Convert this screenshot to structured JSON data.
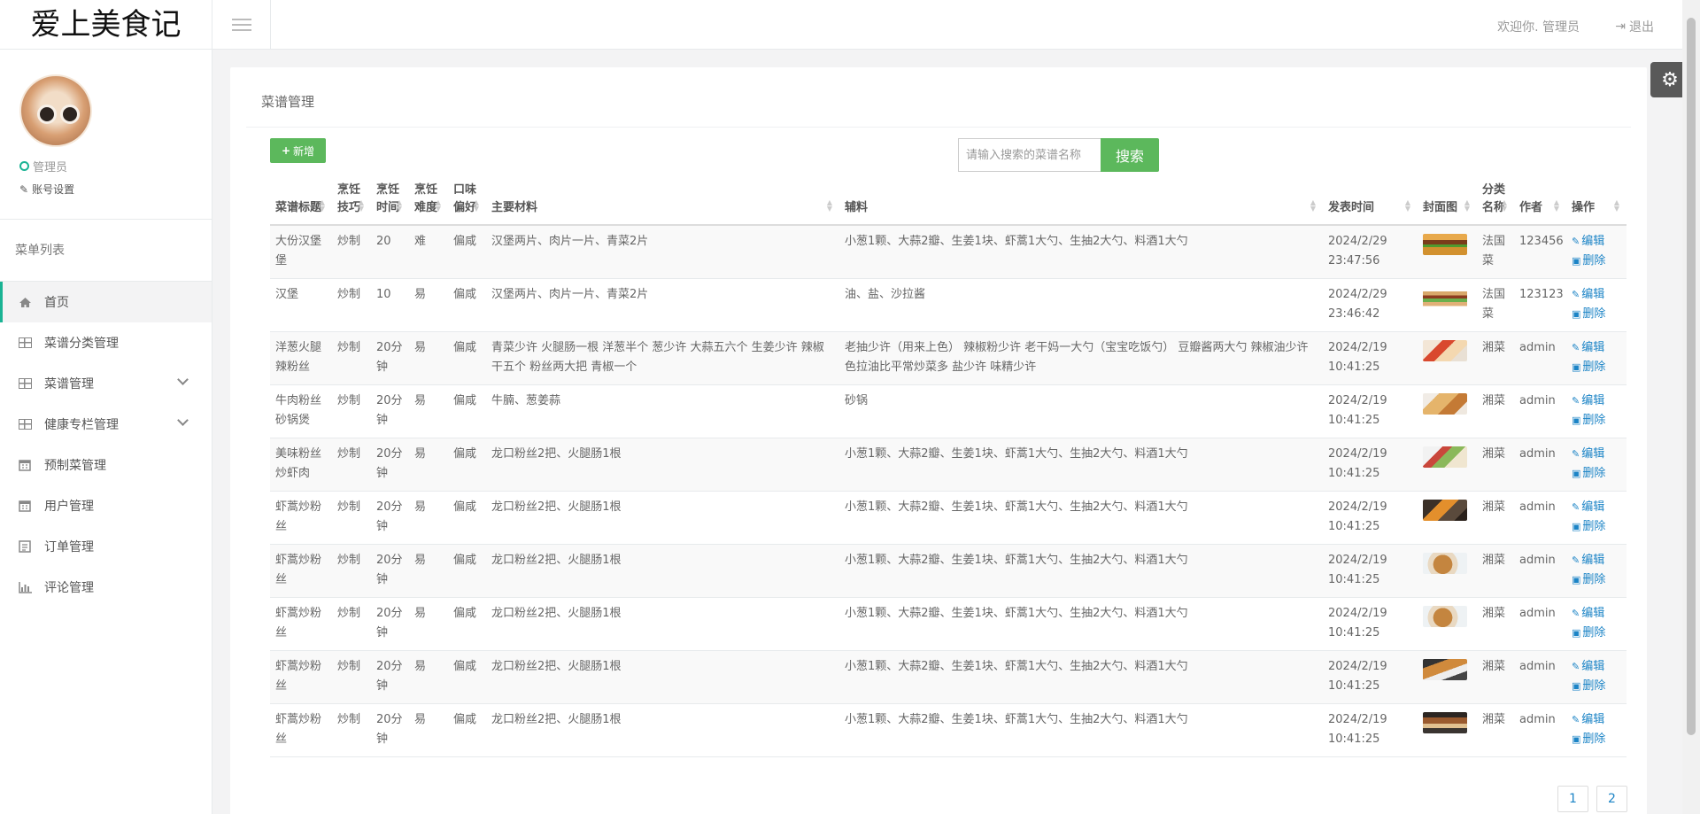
{
  "app": {
    "logo": "爱上美食记"
  },
  "profile": {
    "role": "管理员",
    "account_settings": "账号设置"
  },
  "menu": {
    "title": "菜单列表",
    "items": [
      {
        "label": "首页",
        "icon": "home-icon",
        "active": true,
        "expandable": false
      },
      {
        "label": "菜谱分类管理",
        "icon": "table-icon",
        "active": false,
        "expandable": false
      },
      {
        "label": "菜谱管理",
        "icon": "table-icon",
        "active": false,
        "expandable": true
      },
      {
        "label": "健康专栏管理",
        "icon": "table-icon",
        "active": false,
        "expandable": true
      },
      {
        "label": "预制菜管理",
        "icon": "calendar-icon",
        "active": false,
        "expandable": false
      },
      {
        "label": "用户管理",
        "icon": "calendar-icon",
        "active": false,
        "expandable": false
      },
      {
        "label": "订单管理",
        "icon": "list-icon",
        "active": false,
        "expandable": false
      },
      {
        "label": "评论管理",
        "icon": "bar-chart-icon",
        "active": false,
        "expandable": false
      }
    ]
  },
  "topbar": {
    "welcome": "欢迎你. 管理员",
    "logout": "退出"
  },
  "panel": {
    "title": "菜谱管理",
    "add_button": "新增",
    "search_placeholder": "请输入搜索的菜谱名称",
    "search_button": "搜索"
  },
  "table": {
    "headers": [
      "菜谱标题",
      "烹饪技巧",
      "烹饪时间",
      "烹饪难度",
      "口味偏好",
      "主要材料",
      "辅料",
      "发表时间",
      "封面图",
      "分类名称",
      "作者",
      "操作"
    ],
    "edit_label": "编辑",
    "delete_label": "删除",
    "rows": [
      {
        "title": "大份汉堡堡",
        "technique": "炒制",
        "time": "20",
        "difficulty": "难",
        "taste": "偏咸",
        "main": "汉堡两片、肉片一片、青菜2片",
        "aux": "小葱1颗、大蒜2瓣、生姜1块、虾蒿1大勺、生抽2大勺、料酒1大勺",
        "date": "2024/2/29",
        "clock": "23:47:56",
        "cover": "burger",
        "category": "法国菜",
        "author": "123456"
      },
      {
        "title": "汉堡",
        "technique": "炒制",
        "time": "10",
        "difficulty": "易",
        "taste": "偏咸",
        "main": "汉堡两片、肉片一片、青菜2片",
        "aux": "油、盐、沙拉酱",
        "date": "2024/2/29",
        "clock": "23:46:42",
        "cover": "sandwich",
        "category": "法国菜",
        "author": "123123"
      },
      {
        "title": "洋葱火腿辣粉丝",
        "technique": "炒制",
        "time": "20分钟",
        "difficulty": "易",
        "taste": "偏咸",
        "main": "青菜少许 火腿肠一根 洋葱半个 葱少许 大蒜五六个 生姜少许 辣椒干五个 粉丝两大把 青椒一个",
        "aux": "老抽少许（用来上色） 辣椒粉少许 老干妈一大勺（宝宝吃饭勺） 豆瓣酱两大勺 辣椒油少许 色拉油比平常炒菜多 盐少许 味精少许",
        "date": "2024/2/19",
        "clock": "10:41:25",
        "cover": "noodle-red",
        "category": "湘菜",
        "author": "admin"
      },
      {
        "title": "牛肉粉丝砂锅煲",
        "technique": "炒制",
        "time": "20分钟",
        "difficulty": "易",
        "taste": "偏咸",
        "main": "牛腩、葱姜蒜",
        "aux": "砂锅",
        "date": "2024/2/19",
        "clock": "10:41:25",
        "cover": "pot",
        "category": "湘菜",
        "author": "admin"
      },
      {
        "title": "美味粉丝炒虾肉",
        "technique": "炒制",
        "time": "20分钟",
        "difficulty": "易",
        "taste": "偏咸",
        "main": "龙口粉丝2把、火腿肠1根",
        "aux": "小葱1颗、大蒜2瓣、生姜1块、虾蒿1大勺、生抽2大勺、料酒1大勺",
        "date": "2024/2/19",
        "clock": "10:41:25",
        "cover": "salad",
        "category": "湘菜",
        "author": "admin"
      },
      {
        "title": "虾蒿炒粉丝",
        "technique": "炒制",
        "time": "20分钟",
        "difficulty": "易",
        "taste": "偏咸",
        "main": "龙口粉丝2把、火腿肠1根",
        "aux": "小葱1颗、大蒜2瓣、生姜1块、虾蒿1大勺、生抽2大勺、料酒1大勺",
        "date": "2024/2/19",
        "clock": "10:41:25",
        "cover": "dark",
        "category": "湘菜",
        "author": "admin"
      },
      {
        "title": "虾蒿炒粉丝",
        "technique": "炒制",
        "time": "20分钟",
        "difficulty": "易",
        "taste": "偏咸",
        "main": "龙口粉丝2把、火腿肠1根",
        "aux": "小葱1颗、大蒜2瓣、生姜1块、虾蒿1大勺、生抽2大勺、料酒1大勺",
        "date": "2024/2/19",
        "clock": "10:41:25",
        "cover": "soup",
        "category": "湘菜",
        "author": "admin"
      },
      {
        "title": "虾蒿炒粉丝",
        "technique": "炒制",
        "time": "20分钟",
        "difficulty": "易",
        "taste": "偏咸",
        "main": "龙口粉丝2把、火腿肠1根",
        "aux": "小葱1颗、大蒜2瓣、生姜1块、虾蒿1大勺、生抽2大勺、料酒1大勺",
        "date": "2024/2/19",
        "clock": "10:41:25",
        "cover": "soup",
        "category": "湘菜",
        "author": "admin"
      },
      {
        "title": "虾蒿炒粉丝",
        "technique": "炒制",
        "time": "20分钟",
        "difficulty": "易",
        "taste": "偏咸",
        "main": "龙口粉丝2把、火腿肠1根",
        "aux": "小葱1颗、大蒜2瓣、生姜1块、虾蒿1大勺、生抽2大勺、料酒1大勺",
        "date": "2024/2/19",
        "clock": "10:41:25",
        "cover": "fish",
        "category": "湘菜",
        "author": "admin"
      },
      {
        "title": "虾蒿炒粉丝",
        "technique": "炒制",
        "time": "20分钟",
        "difficulty": "易",
        "taste": "偏咸",
        "main": "龙口粉丝2把、火腿肠1根",
        "aux": "小葱1颗、大蒜2瓣、生姜1块、虾蒿1大勺、生抽2大勺、料酒1大勺",
        "date": "2024/2/19",
        "clock": "10:41:25",
        "cover": "cake",
        "category": "湘菜",
        "author": "admin"
      }
    ]
  },
  "pagination": {
    "pages": [
      "1",
      "2"
    ]
  },
  "colors": {
    "accent_green": "#5cb85c",
    "link_blue": "#1c84c6",
    "active_border": "#1ab394"
  }
}
